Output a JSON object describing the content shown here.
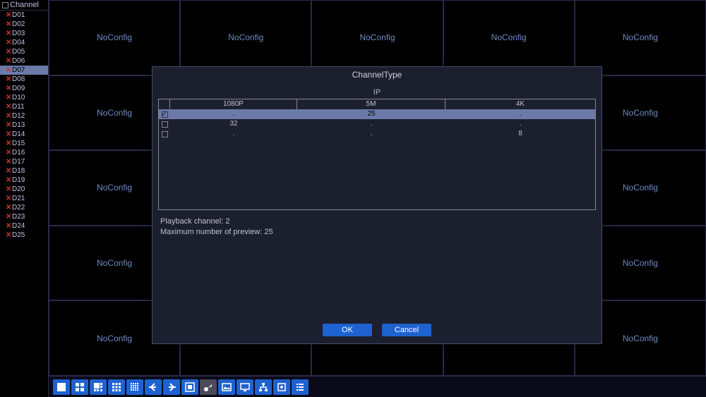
{
  "sidebar": {
    "title": "Channel",
    "selected_index": 6,
    "channels": [
      "D01",
      "D02",
      "D03",
      "D04",
      "D05",
      "D06",
      "D07",
      "D08",
      "D09",
      "D10",
      "D11",
      "D12",
      "D13",
      "D14",
      "D15",
      "D16",
      "D17",
      "D18",
      "D19",
      "D20",
      "D21",
      "D22",
      "D23",
      "D24",
      "D25"
    ]
  },
  "grid": {
    "cell_label": "NoConfig"
  },
  "dialog": {
    "title": "ChannelType",
    "group_label": "IP",
    "columns": {
      "c1": "1080P",
      "c2": "5M",
      "c3": "4K"
    },
    "rows": [
      {
        "checked": true,
        "c1": ".",
        "c2": "25",
        "c3": "."
      },
      {
        "checked": false,
        "c1": "32",
        "c2": ".",
        "c3": "."
      },
      {
        "checked": false,
        "c1": ".",
        "c2": ".",
        "c3": "8"
      }
    ],
    "info1": "Playback channel: 2",
    "info2": "Maximum number of preview: 25",
    "ok": "OK",
    "cancel": "Cancel"
  }
}
